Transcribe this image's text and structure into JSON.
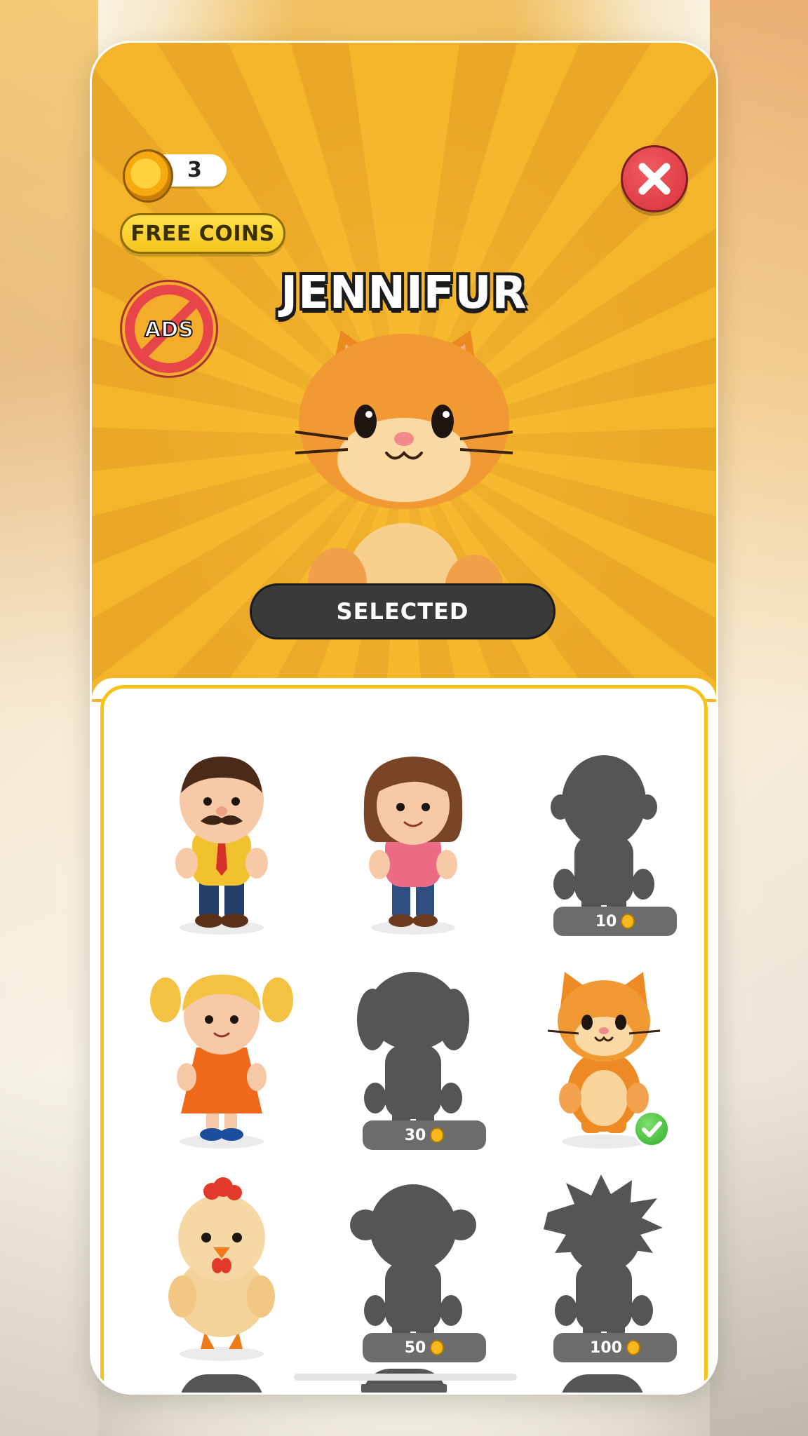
{
  "header": {
    "coin_count": "3",
    "free_coins_label": "FREE COINS",
    "no_ads_label": "ADS"
  },
  "featured": {
    "name": "JENNIFUR",
    "status_label": "SELECTED"
  },
  "grid": {
    "items": [
      {
        "id": "dad",
        "locked": false,
        "selected": false,
        "price": ""
      },
      {
        "id": "mom",
        "locked": false,
        "selected": false,
        "price": ""
      },
      {
        "id": "locked-boy",
        "locked": true,
        "selected": false,
        "price": "10"
      },
      {
        "id": "girl",
        "locked": false,
        "selected": false,
        "price": ""
      },
      {
        "id": "locked-dog",
        "locked": true,
        "selected": false,
        "price": "30"
      },
      {
        "id": "cat",
        "locked": false,
        "selected": true,
        "price": ""
      },
      {
        "id": "chicken",
        "locked": false,
        "selected": false,
        "price": ""
      },
      {
        "id": "locked-monkey",
        "locked": true,
        "selected": false,
        "price": "50"
      },
      {
        "id": "locked-spiky",
        "locked": true,
        "selected": false,
        "price": "100"
      }
    ]
  },
  "colors": {
    "accent": "#f6c218",
    "close": "#d8333a",
    "selected_button": "#3a3a3a",
    "locked_tag": "#6c6c6c"
  }
}
